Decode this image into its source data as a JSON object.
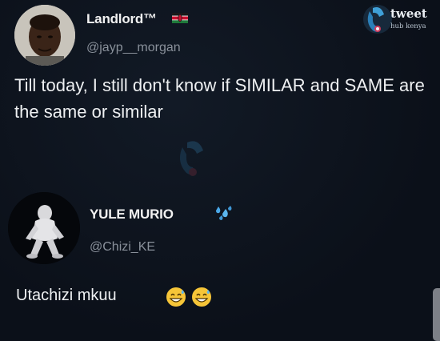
{
  "watermark": {
    "brand": "tweet",
    "sub": "hub kenya"
  },
  "tweet1": {
    "name": "Landlord™",
    "handle": "@jayp__morgan",
    "text": "Till today, I still don't know if SIMILAR and SAME are the same or similar"
  },
  "tweet2": {
    "name": "YULE MURIO",
    "handle": "@Chizi_KE",
    "text": "Utachizi mkuu"
  },
  "icons": {
    "flag": "kenya-flag-icon",
    "sweat": "sweat-droplets-icon",
    "emoji": "grinning-sweat-face-icon"
  }
}
